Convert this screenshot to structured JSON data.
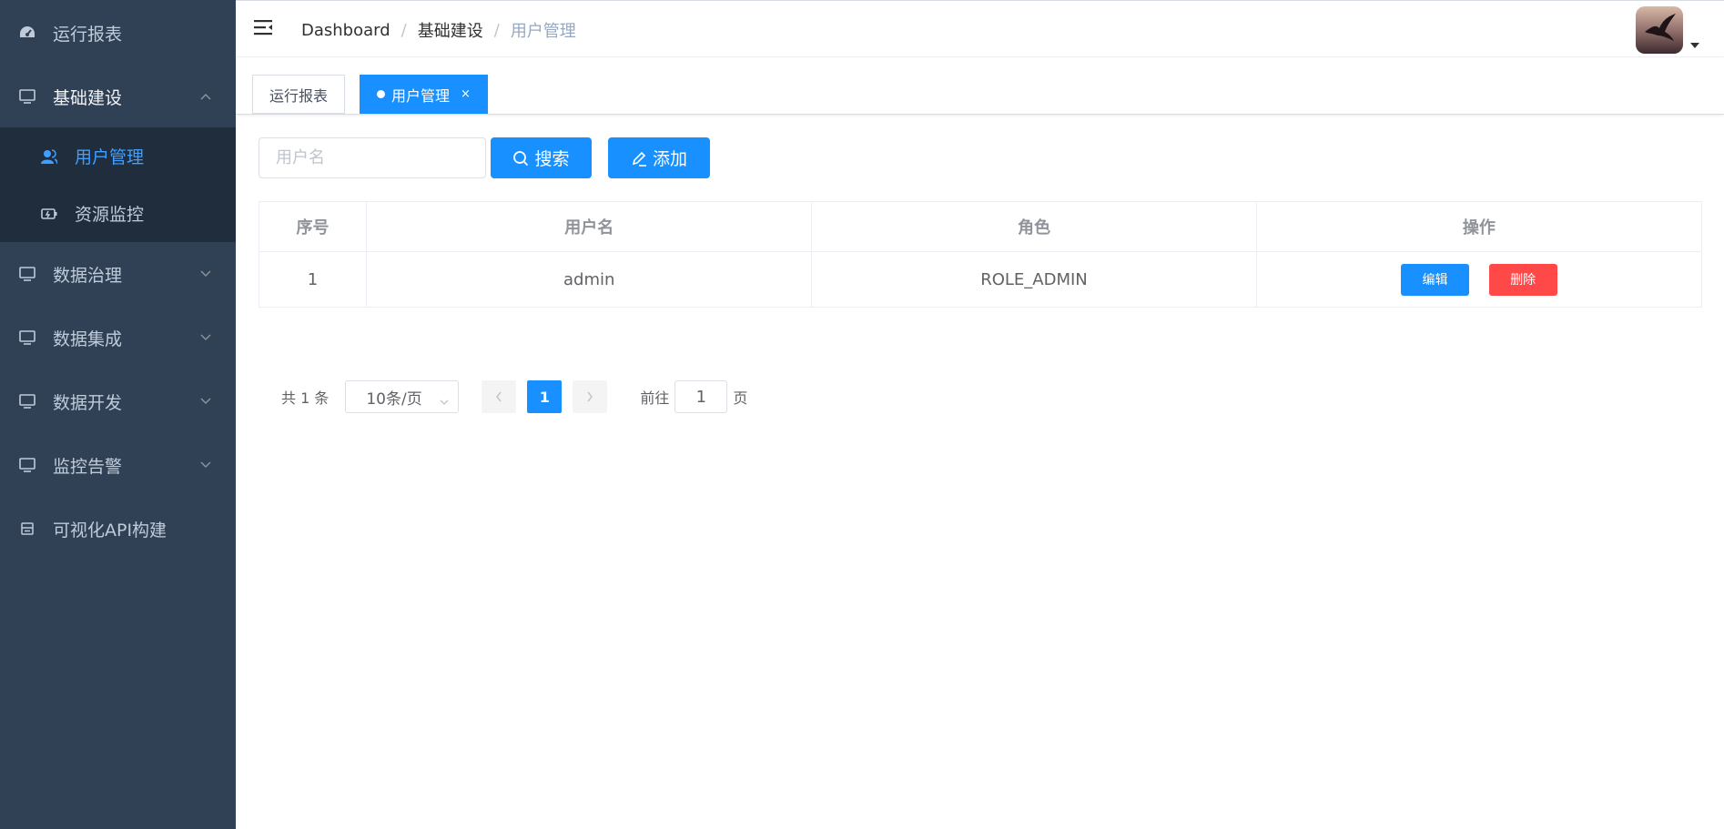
{
  "sidebar": {
    "background_color": "#304156",
    "items": [
      {
        "label": "运行报表",
        "icon": "dashboard-icon"
      },
      {
        "label": "基础建设",
        "icon": "monitor-icon",
        "expanded": true,
        "children": [
          {
            "label": "用户管理",
            "icon": "users-icon",
            "active": true
          },
          {
            "label": "资源监控",
            "icon": "battery-icon"
          }
        ]
      },
      {
        "label": "数据治理",
        "icon": "monitor-icon"
      },
      {
        "label": "数据集成",
        "icon": "monitor-icon"
      },
      {
        "label": "数据开发",
        "icon": "monitor-icon"
      },
      {
        "label": "监控告警",
        "icon": "monitor-icon"
      },
      {
        "label": "可视化API构建",
        "icon": "api-box-icon"
      }
    ]
  },
  "header": {
    "breadcrumb": [
      "Dashboard",
      "基础建设",
      "用户管理"
    ],
    "separator": "/"
  },
  "tags": [
    {
      "label": "运行报表",
      "active": false
    },
    {
      "label": "用户管理",
      "active": true,
      "close": "×"
    }
  ],
  "toolbar": {
    "search_placeholder": "用户名",
    "search_value": "",
    "search_label": "搜索",
    "add_label": "添加",
    "accent_color": "#1890ff"
  },
  "table": {
    "columns": [
      "序号",
      "用户名",
      "角色",
      "操作"
    ],
    "rows": [
      {
        "index": "1",
        "username": "admin",
        "role": "ROLE_ADMIN",
        "edit_label": "编辑",
        "delete_label": "删除"
      }
    ]
  },
  "pagination": {
    "total_text": "共 1 条",
    "page_size": "10条/页",
    "current_page": "1",
    "jump_prefix": "前往",
    "jump_value": "1",
    "jump_suffix": "页"
  }
}
